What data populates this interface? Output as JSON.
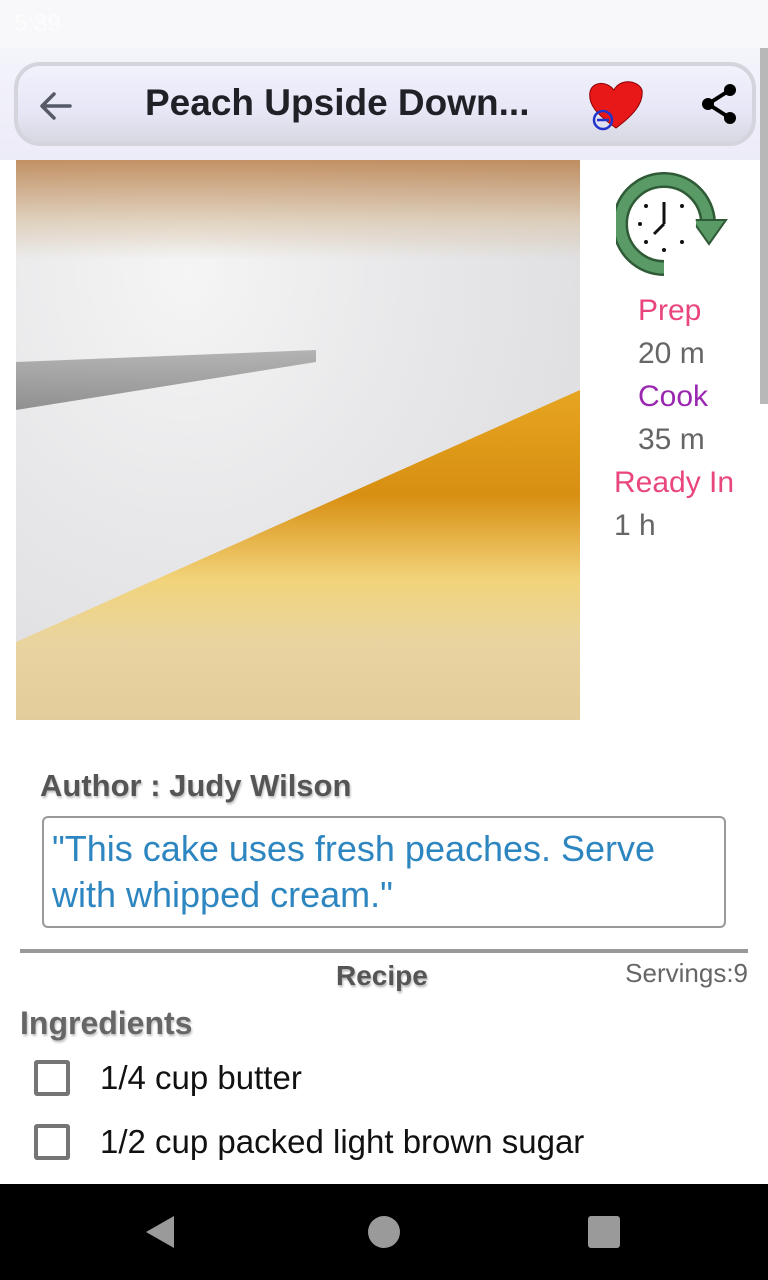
{
  "status_bar": {
    "time": "5:39"
  },
  "toolbar": {
    "title": "Peach Upside Down...",
    "back_icon": "arrow-left-icon",
    "favorite_icon": "heart-icon",
    "share_icon": "share-icon"
  },
  "recipe": {
    "image_alt": "Peach upside down cake slice",
    "times": {
      "prep_label": "Prep",
      "prep_value": "20 m",
      "cook_label": "Cook",
      "cook_value": "35 m",
      "ready_label": "Ready In",
      "ready_value": "1 h"
    },
    "author": "Author : Judy Wilson",
    "description": "\"This cake uses fresh peaches. Serve with whipped cream.\"",
    "section_label": "Recipe",
    "servings": "Servings:9",
    "ingredients_label": "Ingredients",
    "ingredients": [
      {
        "label": "1/4 cup butter",
        "checked": false
      },
      {
        "label": "1/2 cup packed light brown sugar",
        "checked": false
      }
    ]
  },
  "colors": {
    "prep": "#e8467c",
    "cook": "#9a27b0",
    "description": "#2e86c1",
    "clock_green": "#4e8a5a"
  },
  "nav_bar": {
    "back": "nav-back",
    "home": "nav-home",
    "recents": "nav-recents"
  }
}
